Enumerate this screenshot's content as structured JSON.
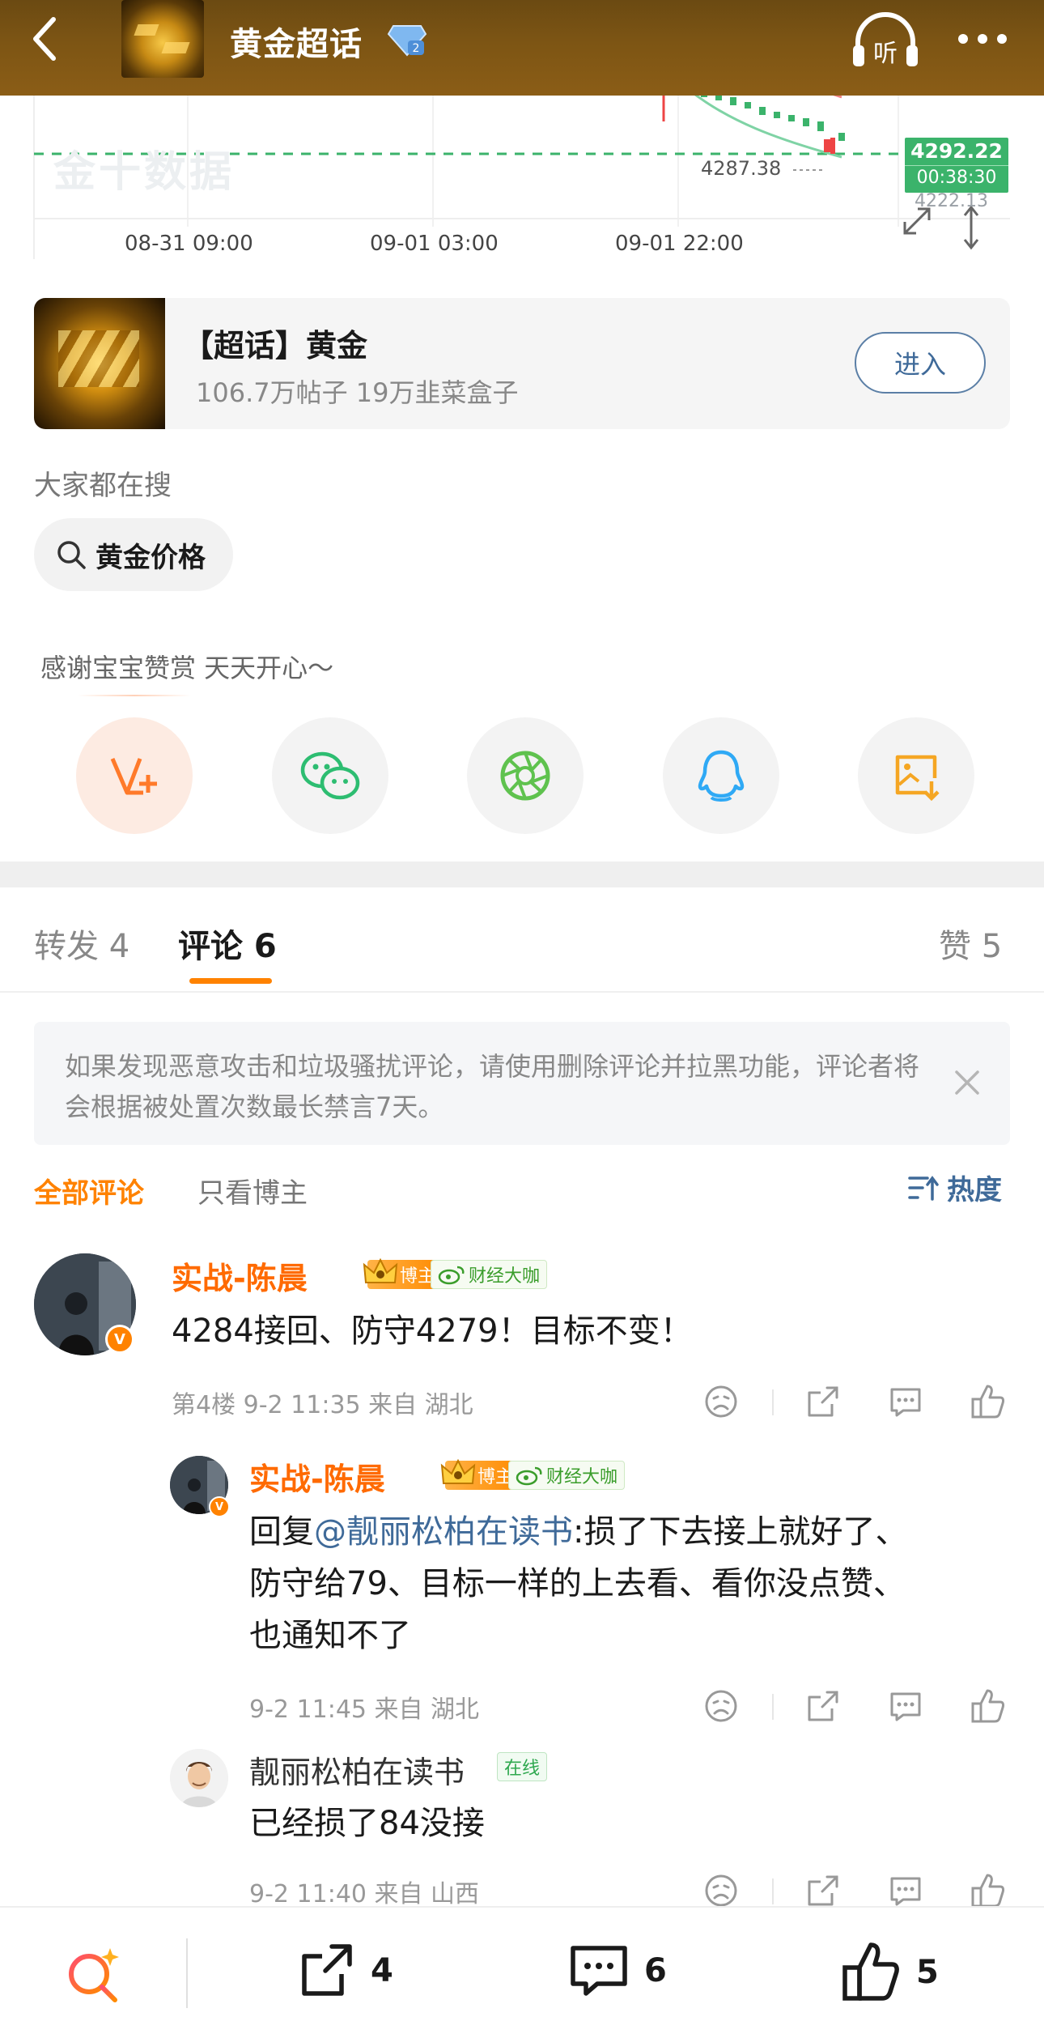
{
  "header": {
    "title": "黄金超话",
    "listen_label": "听"
  },
  "chart": {
    "watermark": "金十数据",
    "x_ticks": [
      "08-31 09:00",
      "09-01 03:00",
      "09-01 22:00"
    ],
    "current_price": "4292.22",
    "countdown": "00:38:30",
    "below_price": "4222.13",
    "low_label": "4287.38"
  },
  "topic_card": {
    "title": "【超话】黄金",
    "subtitle": "106.7万帖子 19万韭菜盒子",
    "enter_label": "进入"
  },
  "search": {
    "heading": "大家都在搜",
    "chip": "黄金价格"
  },
  "thanks": "感谢宝宝赞赏 天天开心～",
  "share": [
    "vip-reward-icon",
    "wechat-icon",
    "moments-icon",
    "qq-icon",
    "save-image-icon"
  ],
  "tabs": {
    "repost": "转发 4",
    "comments": "评论 6",
    "likes": "赞 5"
  },
  "notice": "如果发现恶意攻击和垃圾骚扰评论，请使用删除评论并拉黑功能，评论者将会根据被处置次数最长禁言7天。",
  "filters": {
    "all": "全部评论",
    "owner_only": "只看博主",
    "sort": "热度"
  },
  "comments": [
    {
      "name": "实战-陈晨",
      "owner_badge": "博主",
      "finance_badge": "财经大咖",
      "text": "4284接回、防守4279！目标不变！",
      "meta": "第4楼 9-2 11:35 来自 湖北"
    },
    {
      "name": "实战-陈晨",
      "owner_badge": "博主",
      "finance_badge": "财经大咖",
      "reply_prefix": "回复",
      "mention": "@靓丽松柏在读书",
      "text_line1": ":损了下去接上就好了、",
      "text_line2": "防守给79、目标一样的上去看、看你没点赞、",
      "text_line3": "也通知不了",
      "meta": "9-2 11:45 来自 湖北"
    },
    {
      "name": "靓丽松柏在读书",
      "online_badge": "在线",
      "text": "已经损了84没接",
      "meta": "9-2 11:40 来自 山西"
    }
  ],
  "bottom_bar": {
    "repost_count": "4",
    "comment_count": "6",
    "like_count": "5"
  },
  "colors": {
    "accent": "#ff8200",
    "link": "#3f6a99",
    "price_green": "#3bb36b"
  }
}
